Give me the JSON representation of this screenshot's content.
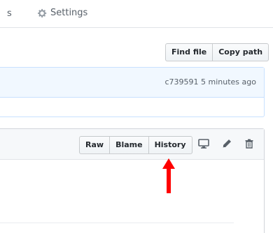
{
  "tabs": {
    "partial_label": "s",
    "settings_label": "Settings"
  },
  "file_navigation": {
    "find_file": "Find file",
    "copy_path": "Copy path"
  },
  "commit": {
    "sha": "c739591",
    "time": "5 minutes ago"
  },
  "file_actions": {
    "raw": "Raw",
    "blame": "Blame",
    "history": "History",
    "icons": [
      "desktop-icon",
      "pencil-icon",
      "trash-icon"
    ]
  },
  "annotation": {
    "arrow_color": "#ff0000",
    "icon": "red-arrow-up-icon"
  }
}
